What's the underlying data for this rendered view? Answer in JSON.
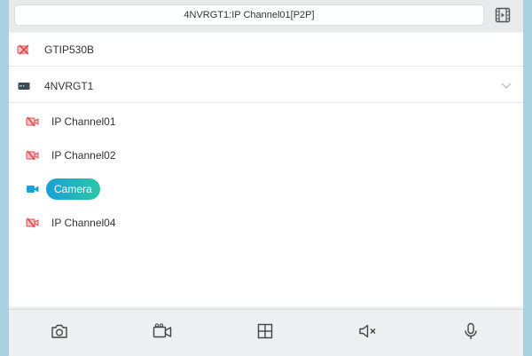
{
  "header": {
    "title": "4NVRGT1:IP Channel01[P2P]",
    "playback_icon": "video-playback-icon"
  },
  "devices": [
    {
      "name": "GTIP530B",
      "icon": "camera-offline-icon"
    },
    {
      "name": "4NVRGT1",
      "icon": "nvr-icon",
      "expanded": true
    }
  ],
  "channels": [
    {
      "name": "IP Channel01",
      "status": "offline",
      "icon": "camera-offline-icon"
    },
    {
      "name": "IP Channel02",
      "status": "offline",
      "icon": "camera-offline-icon"
    },
    {
      "name": "Camera",
      "status": "online",
      "selected": true,
      "icon": "camera-online-icon"
    },
    {
      "name": "IP Channel04",
      "status": "offline",
      "icon": "camera-offline-icon"
    }
  ],
  "toolbar": [
    {
      "icon": "snapshot-icon"
    },
    {
      "icon": "record-icon"
    },
    {
      "icon": "split-screen-icon"
    },
    {
      "icon": "mute-icon"
    },
    {
      "icon": "microphone-icon"
    }
  ],
  "colors": {
    "accent_start": "#1b9fd6",
    "accent_end": "#2cc7a8",
    "offline_red": "#e0484d",
    "online_blue": "#1ea0db"
  }
}
